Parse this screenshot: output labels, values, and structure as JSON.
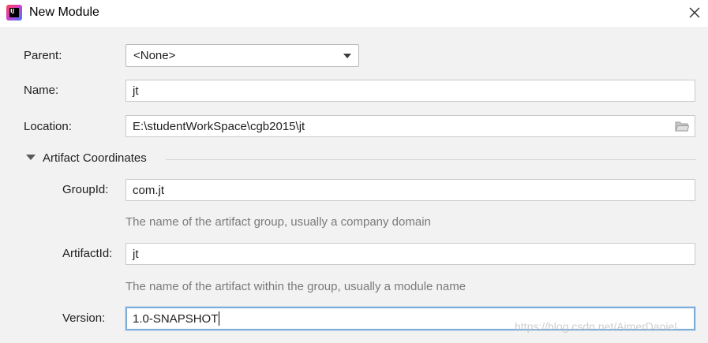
{
  "window": {
    "title": "New Module",
    "icon_text": "IJ"
  },
  "form": {
    "parent_label": "Parent:",
    "parent_value": "<None>",
    "name_label": "Name:",
    "name_value": "jt",
    "location_label": "Location:",
    "location_value": "E:\\studentWorkSpace\\cgb2015\\jt"
  },
  "artifact": {
    "section_title": "Artifact Coordinates",
    "groupid_label": "GroupId:",
    "groupid_value": "com.jt",
    "groupid_hint": "The name of the artifact group, usually a company domain",
    "artifactid_label": "ArtifactId:",
    "artifactid_value": "jt",
    "artifactid_hint": "The name of the artifact within the group, usually a module name",
    "version_label": "Version:",
    "version_value": "1.0-SNAPSHOT"
  },
  "watermark": "https://blog.csdn.net/AimerDaniel",
  "colors": {
    "background": "#f2f2f2",
    "focus_border": "#7eadd7",
    "hint_text": "#7a7a7a"
  },
  "icons": [
    "intellij-app-icon",
    "close-icon",
    "dropdown-arrow-icon",
    "folder-icon",
    "collapse-triangle-icon"
  ]
}
